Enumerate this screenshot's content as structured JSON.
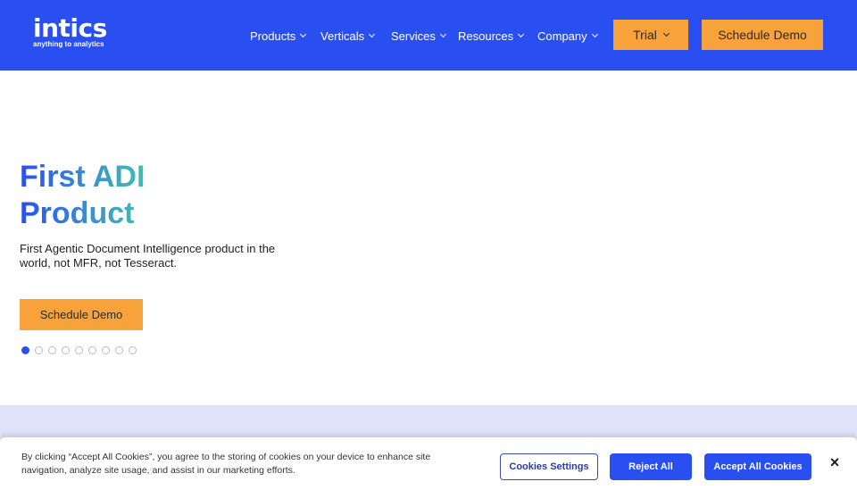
{
  "brand": {
    "logo_text": "intics",
    "tagline": "anything to analytics",
    "primary_color": "#2a4ff0",
    "accent_color": "#f7a23a"
  },
  "nav": {
    "items": [
      {
        "label": "Products",
        "icon": "chevron-down-icon"
      },
      {
        "label": "Verticals",
        "icon": "chevron-down-icon"
      },
      {
        "label": "Services",
        "icon": "chevron-down-icon"
      },
      {
        "label": "Resources",
        "icon": "chevron-down-icon"
      },
      {
        "label": "Company",
        "icon": "chevron-down-icon"
      }
    ],
    "trial_label": "Trial",
    "demo_label": "Schedule Demo"
  },
  "hero": {
    "title_line1": "First ADI",
    "title_line2": "Product",
    "subtitle": "First Agentic Document Intelligence product in the world, not MFR, not Tesseract.",
    "cta_label": "Schedule Demo",
    "slide_count": 9,
    "active_slide": 1
  },
  "cookie_banner": {
    "text": "By clicking “Accept All Cookies”, you agree to the storing of cookies on your device to enhance site navigation, analyze site usage, and assist in our marketing efforts.",
    "settings_label": "Cookies Settings",
    "reject_label": "Reject All",
    "accept_label": "Accept All Cookies",
    "close_icon": "close-icon",
    "close_glyph": "×"
  }
}
